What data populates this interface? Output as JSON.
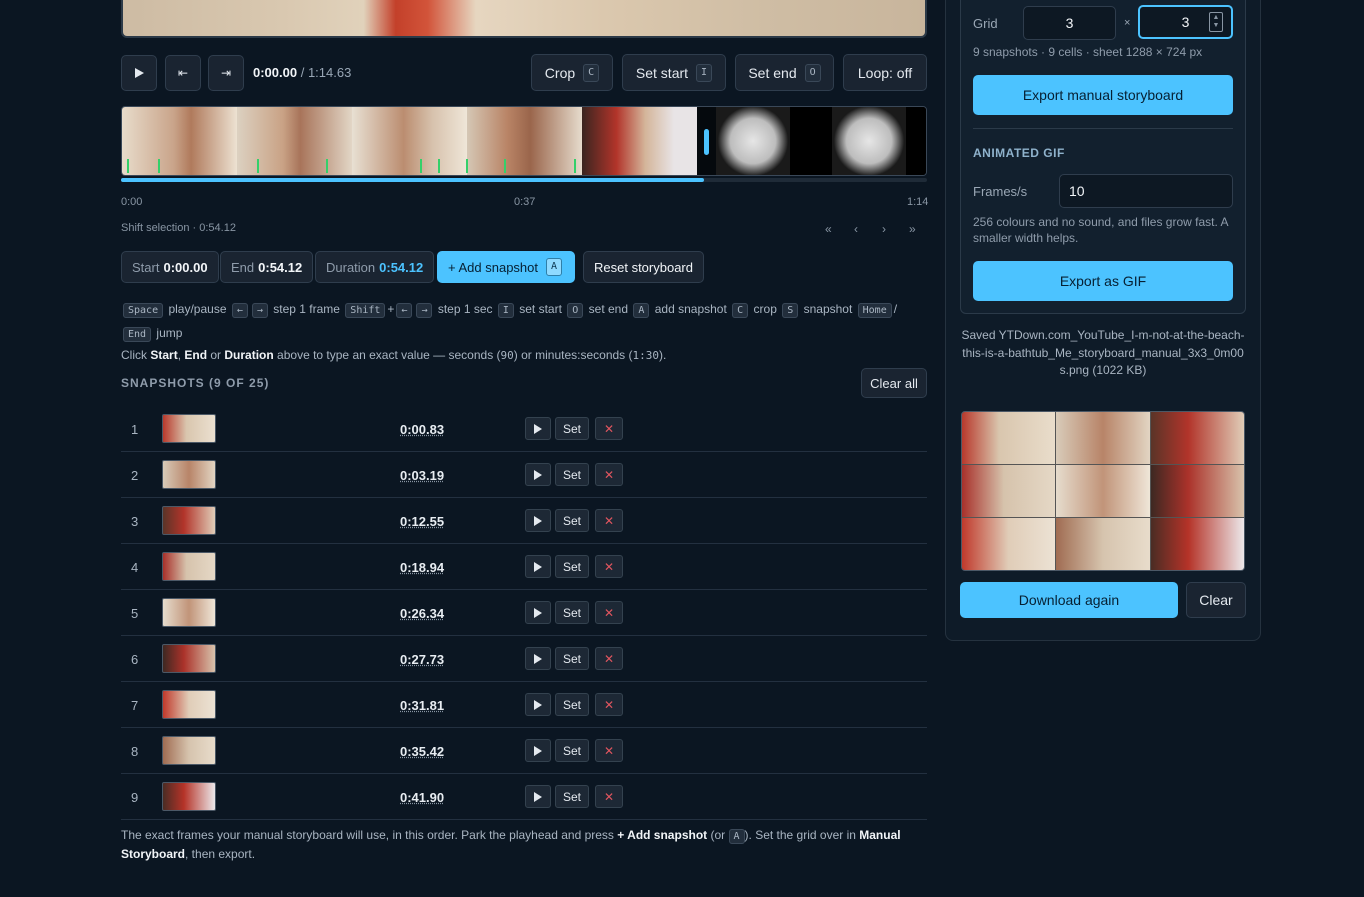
{
  "player": {
    "current_time": "0:00.00",
    "separator": " / ",
    "total_time": "1:14.63",
    "crop_label": "Crop",
    "crop_key": "C",
    "set_start_label": "Set start",
    "set_start_key": "I",
    "set_end_label": "Set end",
    "set_end_key": "O",
    "loop_label": "Loop: off"
  },
  "timeline": {
    "axis": [
      "0:00",
      "0:37",
      "1:14"
    ],
    "shift_selection": "Shift selection · 0:54.12",
    "nav": [
      "«",
      "‹",
      "›",
      "»"
    ]
  },
  "selection": {
    "start_label": "Start",
    "start_value": "0:00.00",
    "end_label": "End",
    "end_value": "0:54.12",
    "duration_label": "Duration",
    "duration_value": "0:54.12",
    "add_snapshot": "+ Add snapshot",
    "add_snapshot_key": "A",
    "reset_storyboard": "Reset storyboard"
  },
  "shortcuts": {
    "space": "Space",
    "play_pause": "play/pause",
    "left": "←",
    "right": "→",
    "step_frame": "step 1 frame",
    "shift": "Shift",
    "plus": "+",
    "step_sec": "step 1 sec",
    "i": "I",
    "set_start": "set start",
    "o": "O",
    "set_end": "set end",
    "a": "A",
    "add_snapshot": "add snapshot",
    "c": "C",
    "crop": "crop",
    "s": "S",
    "snapshot": "snapshot",
    "home": "Home",
    "slash": "/",
    "end": "End",
    "jump": "jump"
  },
  "hint": {
    "p1": "Click ",
    "start": "Start",
    "comma": ", ",
    "end": "End",
    "or": " or ",
    "duration": "Duration",
    "p2": " above to type an exact value — seconds (",
    "ex1": "90",
    "p3": ") or minutes:seconds (",
    "ex2": "1:30",
    "p4": ")."
  },
  "snapshots": {
    "title": "SNAPSHOTS (9 OF 25)",
    "clear_all": "Clear all",
    "set_label": "Set",
    "items": [
      {
        "index": "1",
        "time": "0:00.83"
      },
      {
        "index": "2",
        "time": "0:03.19"
      },
      {
        "index": "3",
        "time": "0:12.55"
      },
      {
        "index": "4",
        "time": "0:18.94"
      },
      {
        "index": "5",
        "time": "0:26.34"
      },
      {
        "index": "6",
        "time": "0:27.73"
      },
      {
        "index": "7",
        "time": "0:31.81"
      },
      {
        "index": "8",
        "time": "0:35.42"
      },
      {
        "index": "9",
        "time": "0:41.90"
      }
    ]
  },
  "footnote": {
    "p1": "The exact frames your manual storyboard will use, in this order. Park the playhead and press ",
    "add": "+ Add snapshot",
    "p2": " (or ",
    "key": "A",
    "p3": "). Set the grid over in ",
    "manual": "Manual Storyboard",
    "p4": ", then export."
  },
  "storyboard": {
    "grid_label": "Grid",
    "cols": "3",
    "times": "×",
    "rows": "3",
    "info": "9 snapshots · 9 cells · sheet 1288 × 724 px",
    "export_label": "Export manual storyboard"
  },
  "gif": {
    "title": "ANIMATED GIF",
    "fps_label": "Frames/s",
    "fps_value": "10",
    "note": "256 colours and no sound, and files grow fast. A smaller width helps.",
    "export_label": "Export as GIF"
  },
  "saved": {
    "message": "Saved YTDown.com_YouTube_I-m-not-at-the-beach-this-is-a-bathtub_Me_storyboard_manual_3x3_0m00s.png (1022 KB)",
    "download_again": "Download again",
    "clear": "Clear"
  },
  "colors": {
    "accent": "#4cc3ff",
    "marker": "#34d06a",
    "danger": "#e0555f",
    "background": "#0b1622"
  }
}
